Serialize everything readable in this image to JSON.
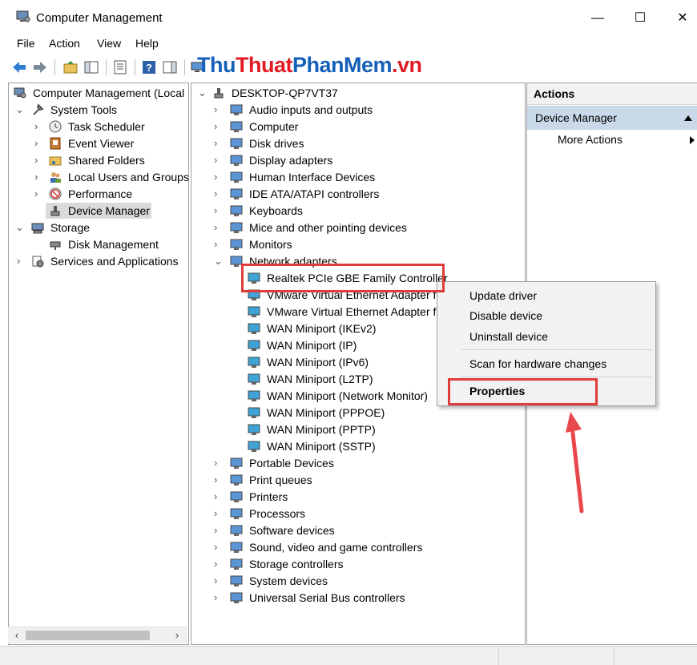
{
  "window": {
    "title": "Computer Management",
    "min": "—",
    "max": "☐",
    "close": "✕"
  },
  "menu": [
    "File",
    "Action",
    "View",
    "Help"
  ],
  "watermark": {
    "p1": "Thu",
    "p2": "Thuat",
    "p3": "PhanMem",
    "p4": ".vn"
  },
  "left_tree": [
    {
      "label": "Computer Management (Local",
      "icon": "computer-management-icon"
    },
    {
      "label": "System Tools",
      "icon": "system-tools-icon"
    },
    {
      "label": "Task Scheduler",
      "icon": "clock-icon"
    },
    {
      "label": "Event Viewer",
      "icon": "event-viewer-icon"
    },
    {
      "label": "Shared Folders",
      "icon": "shared-folder-icon"
    },
    {
      "label": "Local Users and Groups",
      "icon": "users-icon"
    },
    {
      "label": "Performance",
      "icon": "performance-icon"
    },
    {
      "label": "Device Manager",
      "icon": "device-manager-icon"
    },
    {
      "label": "Storage",
      "icon": "storage-icon"
    },
    {
      "label": "Disk Management",
      "icon": "disk-management-icon"
    },
    {
      "label": "Services and Applications",
      "icon": "services-icon"
    }
  ],
  "device_tree": {
    "root": "DESKTOP-QP7VT37",
    "categories_top": [
      "Audio inputs and outputs",
      "Computer",
      "Disk drives",
      "Display adapters",
      "Human Interface Devices",
      "IDE ATA/ATAPI controllers",
      "Keyboards",
      "Mice and other pointing devices",
      "Monitors",
      "Network adapters"
    ],
    "network_adapters": [
      "Realtek PCIe GBE Family Controller",
      "VMware Virtual Ethernet Adapter fo",
      "VMware Virtual Ethernet Adapter fo",
      "WAN Miniport (IKEv2)",
      "WAN Miniport (IP)",
      "WAN Miniport (IPv6)",
      "WAN Miniport (L2TP)",
      "WAN Miniport (Network Monitor)",
      "WAN Miniport (PPPOE)",
      "WAN Miniport (PPTP)",
      "WAN Miniport (SSTP)"
    ],
    "categories_bottom": [
      "Portable Devices",
      "Print queues",
      "Printers",
      "Processors",
      "Software devices",
      "Sound, video and game controllers",
      "Storage controllers",
      "System devices",
      "Universal Serial Bus controllers"
    ]
  },
  "actions": {
    "header": "Actions",
    "section": "Device Manager",
    "more": "More Actions"
  },
  "context_menu": {
    "update": "Update driver",
    "disable": "Disable device",
    "uninstall": "Uninstall device",
    "scan": "Scan for hardware changes",
    "properties": "Properties"
  },
  "colors": {
    "highlight": "#e03c3c",
    "arrow": "#e8474c",
    "section_bg": "#c9d9ea"
  }
}
